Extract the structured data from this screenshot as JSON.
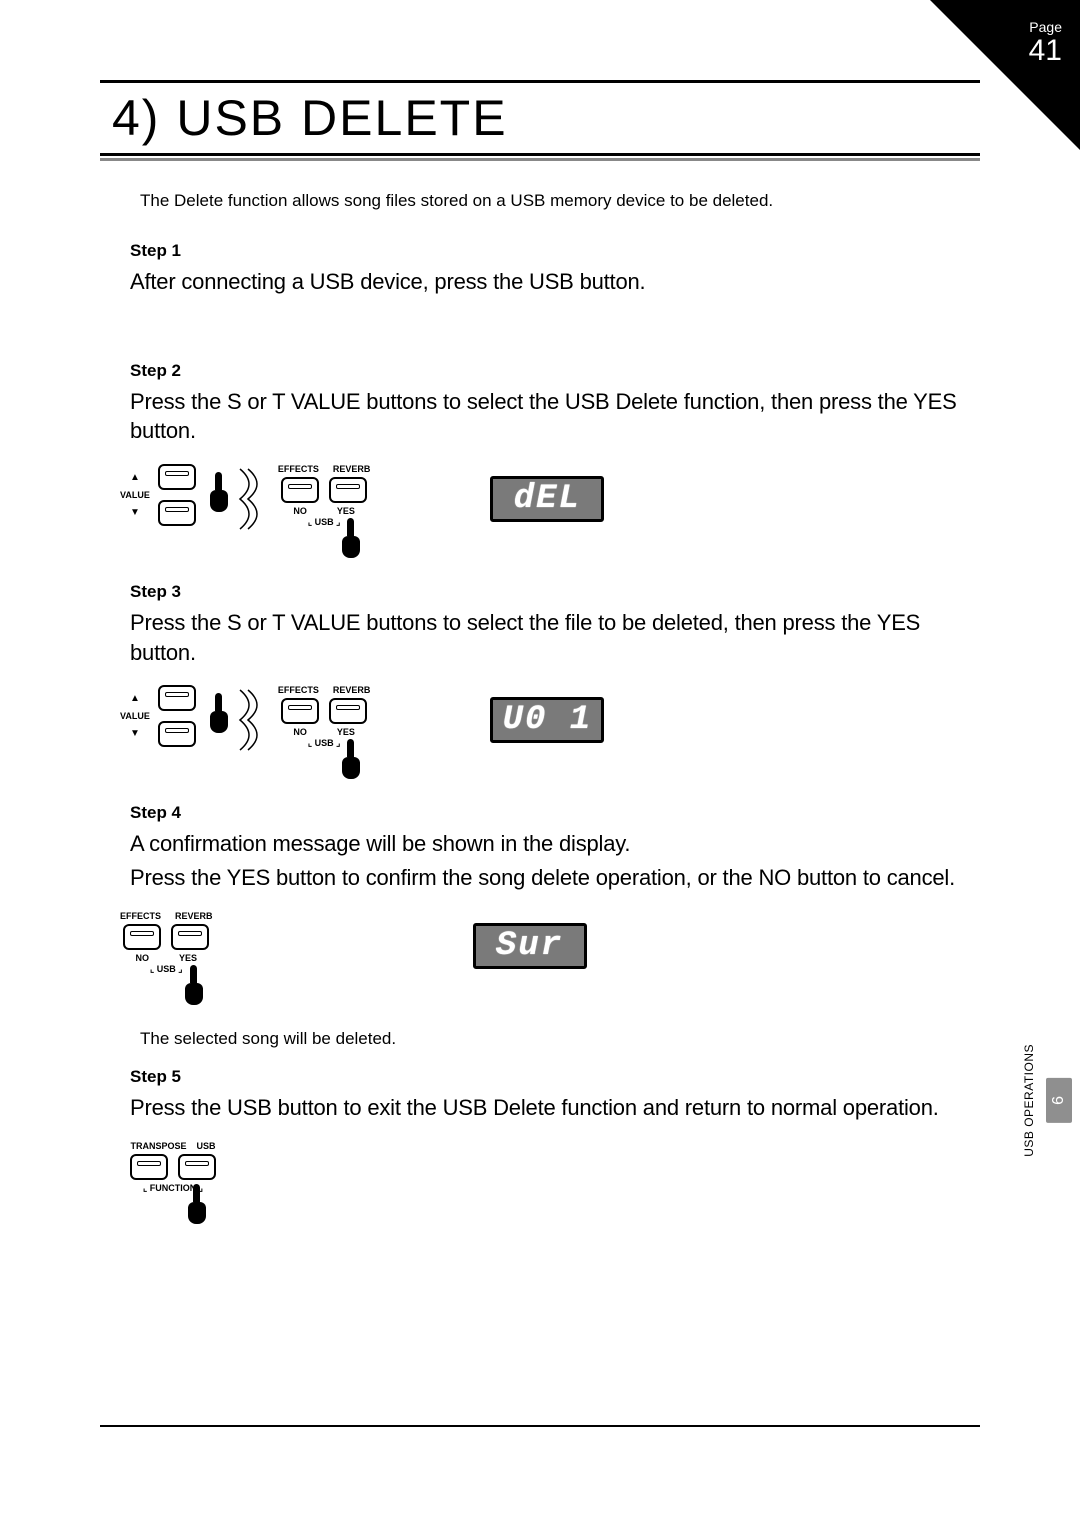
{
  "corner": {
    "label": "Page",
    "number": "41"
  },
  "title": "4) USB DELETE",
  "intro": "The Delete function allows song files stored on a USB memory device to be deleted.",
  "steps": {
    "s1": {
      "label": "Step 1",
      "text": "After connecting a USB device, press the USB button."
    },
    "s2": {
      "label": "Step 2",
      "text": "Press the  S  or  T  VALUE buttons to select the USB Delete function, then press the YES button."
    },
    "s3": {
      "label": "Step 3",
      "text": "Press the  S  or  T  VALUE buttons to select the file to be deleted, then press the YES button."
    },
    "s4": {
      "label": "Step 4",
      "line1": "A confirmation message will be shown in the display.",
      "line2": "Press the YES button to confirm the song delete operation, or the NO button to cancel."
    },
    "s5": {
      "label": "Step 5",
      "text": "Press the USB button to exit the USB Delete function and return to normal operation."
    }
  },
  "panel": {
    "value_label": "VALUE",
    "effects": "EFFECTS",
    "reverb": "REVERB",
    "no": "NO",
    "yes": "YES",
    "usb_small": "USB",
    "transpose": "TRANSPOSE",
    "usb": "USB",
    "function": "FUNCTION"
  },
  "displays": {
    "d1": "dEL",
    "d2": "U0 1",
    "d3": "Sur"
  },
  "note_after_s4": "The selected song will be deleted.",
  "side": {
    "section": "USB OPERATIONS",
    "chapter": "6"
  }
}
